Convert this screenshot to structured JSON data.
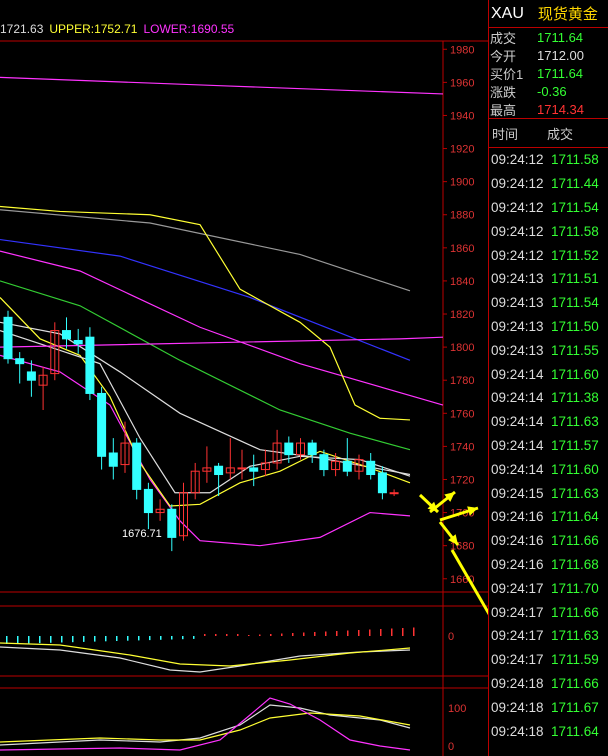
{
  "legend": {
    "mid": "1721.63",
    "upper": "UPPER:1752.71",
    "lower": "LOWER:1690.55"
  },
  "price_axis": [
    "1980",
    "1960",
    "1940",
    "1920",
    "1900",
    "1880",
    "1860",
    "1840",
    "1820",
    "1800",
    "1780",
    "1760",
    "1740",
    "1720",
    "1700",
    "1680",
    "1660"
  ],
  "macd_axis": [
    "0"
  ],
  "kdj_axis": [
    "100",
    "0"
  ],
  "low_label": "1676.71",
  "panel": {
    "symbol": "XAU",
    "name": "现货黄金",
    "quotes": [
      {
        "label": "成交",
        "value": "1711.64",
        "color": "green"
      },
      {
        "label": "今开",
        "value": "1712.00",
        "color": "white"
      },
      {
        "label": "买价1",
        "value": "1711.64",
        "color": "green"
      },
      {
        "label": "涨跌",
        "value": "-0.36",
        "color": "green"
      },
      {
        "label": "最高",
        "value": "1714.34",
        "color": "red"
      }
    ],
    "ticks_header": {
      "time": "时间",
      "price": "成交"
    },
    "ticks": [
      {
        "time": "09:24:12",
        "price": "1711.58"
      },
      {
        "time": "09:24:12",
        "price": "1711.44"
      },
      {
        "time": "09:24:12",
        "price": "1711.54"
      },
      {
        "time": "09:24:12",
        "price": "1711.58"
      },
      {
        "time": "09:24:12",
        "price": "1711.52"
      },
      {
        "time": "09:24:13",
        "price": "1711.51"
      },
      {
        "time": "09:24:13",
        "price": "1711.54"
      },
      {
        "time": "09:24:13",
        "price": "1711.50"
      },
      {
        "time": "09:24:13",
        "price": "1711.55"
      },
      {
        "time": "09:24:14",
        "price": "1711.60"
      },
      {
        "time": "09:24:14",
        "price": "1711.38"
      },
      {
        "time": "09:24:14",
        "price": "1711.63"
      },
      {
        "time": "09:24:14",
        "price": "1711.57"
      },
      {
        "time": "09:24:14",
        "price": "1711.60"
      },
      {
        "time": "09:24:15",
        "price": "1711.63"
      },
      {
        "time": "09:24:16",
        "price": "1711.64"
      },
      {
        "time": "09:24:16",
        "price": "1711.66"
      },
      {
        "time": "09:24:16",
        "price": "1711.68"
      },
      {
        "time": "09:24:17",
        "price": "1711.70"
      },
      {
        "time": "09:24:17",
        "price": "1711.66"
      },
      {
        "time": "09:24:17",
        "price": "1711.63"
      },
      {
        "time": "09:24:17",
        "price": "1711.59"
      },
      {
        "time": "09:24:18",
        "price": "1711.66"
      },
      {
        "time": "09:24:18",
        "price": "1711.67"
      },
      {
        "time": "09:24:18",
        "price": "1711.64"
      }
    ]
  },
  "candles": [
    {
      "o": 1818,
      "c": 1793,
      "h": 1822,
      "l": 1790
    },
    {
      "o": 1793,
      "c": 1790,
      "h": 1797,
      "l": 1778
    },
    {
      "o": 1785,
      "c": 1780,
      "h": 1792,
      "l": 1770
    },
    {
      "o": 1777,
      "c": 1783,
      "h": 1788,
      "l": 1762
    },
    {
      "o": 1784,
      "c": 1810,
      "h": 1815,
      "l": 1780
    },
    {
      "o": 1810,
      "c": 1805,
      "h": 1818,
      "l": 1799
    },
    {
      "o": 1804,
      "c": 1802,
      "h": 1811,
      "l": 1796
    },
    {
      "o": 1806,
      "c": 1772,
      "h": 1812,
      "l": 1768
    },
    {
      "o": 1772,
      "c": 1734,
      "h": 1776,
      "l": 1726
    },
    {
      "o": 1736,
      "c": 1728,
      "h": 1745,
      "l": 1720
    },
    {
      "o": 1729,
      "c": 1742,
      "h": 1755,
      "l": 1724
    },
    {
      "o": 1742,
      "c": 1714,
      "h": 1745,
      "l": 1708
    },
    {
      "o": 1714,
      "c": 1700,
      "h": 1718,
      "l": 1690
    },
    {
      "o": 1700,
      "c": 1702,
      "h": 1708,
      "l": 1695
    },
    {
      "o": 1702,
      "c": 1685,
      "h": 1705,
      "l": 1676.71
    },
    {
      "o": 1686,
      "c": 1712,
      "h": 1718,
      "l": 1683
    },
    {
      "o": 1712,
      "c": 1725,
      "h": 1730,
      "l": 1708
    },
    {
      "o": 1725,
      "c": 1727,
      "h": 1740,
      "l": 1718
    },
    {
      "o": 1728,
      "c": 1723,
      "h": 1730,
      "l": 1710
    },
    {
      "o": 1724,
      "c": 1727,
      "h": 1745,
      "l": 1720
    },
    {
      "o": 1727,
      "c": 1727,
      "h": 1738,
      "l": 1720
    },
    {
      "o": 1727,
      "c": 1725,
      "h": 1735,
      "l": 1716
    },
    {
      "o": 1726,
      "c": 1730,
      "h": 1738,
      "l": 1722
    },
    {
      "o": 1730,
      "c": 1742,
      "h": 1750,
      "l": 1726
    },
    {
      "o": 1742,
      "c": 1735,
      "h": 1746,
      "l": 1730
    },
    {
      "o": 1735,
      "c": 1742,
      "h": 1745,
      "l": 1732
    },
    {
      "o": 1742,
      "c": 1735,
      "h": 1744,
      "l": 1730
    },
    {
      "o": 1735,
      "c": 1726,
      "h": 1738,
      "l": 1722
    },
    {
      "o": 1726,
      "c": 1731,
      "h": 1736,
      "l": 1722
    },
    {
      "o": 1731,
      "c": 1725,
      "h": 1745,
      "l": 1722
    },
    {
      "o": 1725,
      "c": 1732,
      "h": 1735,
      "l": 1720
    },
    {
      "o": 1731,
      "c": 1723,
      "h": 1736,
      "l": 1720
    },
    {
      "o": 1724,
      "c": 1712,
      "h": 1728,
      "l": 1708
    },
    {
      "o": 1712,
      "c": 1712,
      "h": 1714,
      "l": 1710
    }
  ],
  "colors": {
    "up": "#f33",
    "down": "#3ff",
    "grid": "#b00",
    "ma_white": "#ddd",
    "ma_yellow": "#ff3",
    "ma_green": "#3c3",
    "ma_magenta": "#f3f",
    "ma_blue": "#33f",
    "ma_gray": "#999",
    "arrow": "#ff0"
  }
}
